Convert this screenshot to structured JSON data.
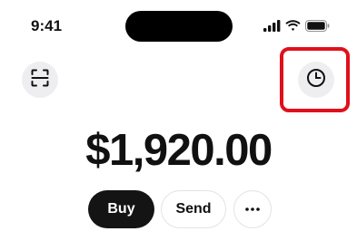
{
  "status_bar": {
    "time": "9:41",
    "icons": [
      "cellular-signal-icon",
      "wifi-icon",
      "battery-icon"
    ]
  },
  "header": {
    "scan_icon": "scan-qr-icon",
    "history_icon": "clock-history-icon",
    "highlight_color": "#e0101a"
  },
  "balance": {
    "amount": "$1,920.00"
  },
  "actions": {
    "buy_label": "Buy",
    "send_label": "Send",
    "more_icon": "ellipsis-icon"
  },
  "colors": {
    "primary_button": "#141414",
    "circle_button_bg": "#eeeef0"
  }
}
